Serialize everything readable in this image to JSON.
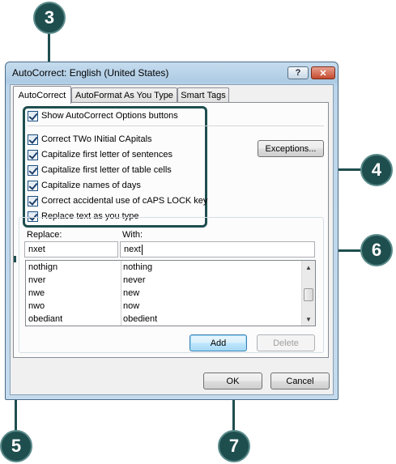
{
  "callouts": {
    "c3": "3",
    "c4": "4",
    "c5": "5",
    "c6": "6",
    "c7": "7"
  },
  "dialog": {
    "title": "AutoCorrect: English (United States)",
    "help_label": "?",
    "close_label": "✕",
    "tabs": [
      {
        "label": "AutoCorrect",
        "active": true
      },
      {
        "label": "AutoFormat As You Type",
        "active": false
      },
      {
        "label": "Smart Tags",
        "active": false
      }
    ],
    "show_options": {
      "label": "Show AutoCorrect Options buttons",
      "checked": true
    },
    "options": [
      {
        "label": "Correct TWo INitial CApitals",
        "checked": true
      },
      {
        "label": "Capitalize first letter of sentences",
        "checked": true
      },
      {
        "label": "Capitalize first letter of table cells",
        "checked": true
      },
      {
        "label": "Capitalize names of days",
        "checked": true
      },
      {
        "label": "Correct accidental use of cAPS LOCK key",
        "checked": true
      },
      {
        "label": "Replace text as you type",
        "checked": true
      }
    ],
    "exceptions_label": "Exceptions...",
    "replace_label": "Replace:",
    "with_label": "With:",
    "replace_value": "nxet",
    "with_value": "next",
    "list": [
      {
        "replace": "nothign",
        "with": "nothing"
      },
      {
        "replace": "nver",
        "with": "never"
      },
      {
        "replace": "nwe",
        "with": "new"
      },
      {
        "replace": "nwo",
        "with": "now"
      },
      {
        "replace": "obediant",
        "with": "obedient"
      }
    ],
    "add_label": "Add",
    "delete_label": "Delete",
    "ok_label": "OK",
    "cancel_label": "Cancel"
  },
  "colors": {
    "callout": "#1f4e4f",
    "highlight": "#1f4e4f"
  }
}
